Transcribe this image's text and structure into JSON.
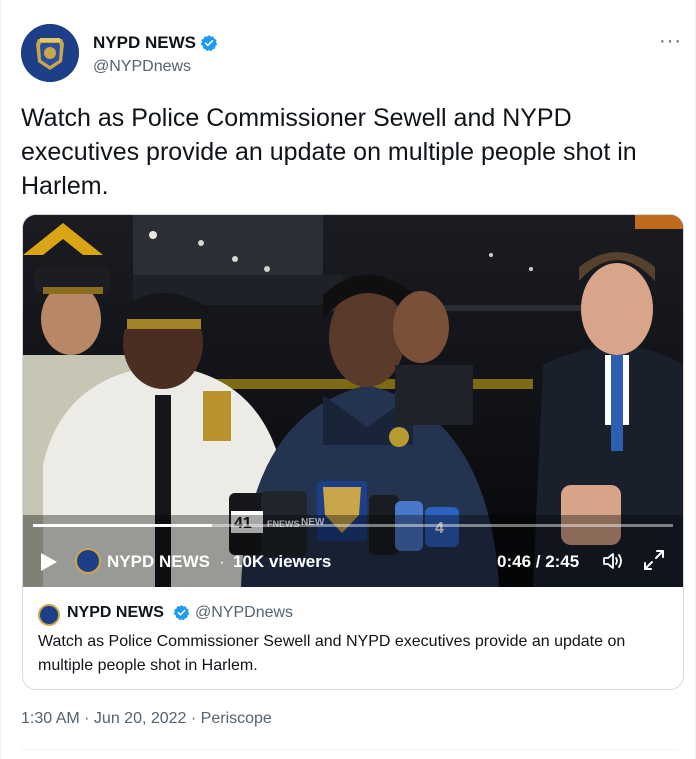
{
  "author": {
    "display_name": "NYPD NEWS",
    "handle": "@NYPDnews",
    "verified": true
  },
  "more_icon": "more-horizontal-icon",
  "tweet_text": "Watch as Police Commissioner Sewell and NYPD executives provide an update on multiple people shot in Harlem.",
  "video": {
    "channel_name": "NYPD NEWS",
    "separator": "·",
    "viewers": "10K viewers",
    "time": "0:46 / 2:45",
    "progress": 0.279,
    "mic_labels": [
      "41",
      "FNEWS",
      "NEW",
      "4"
    ]
  },
  "card": {
    "display_name": "NYPD NEWS",
    "handle": "@NYPDnews",
    "text": "Watch as Police Commissioner Sewell and NYPD executives provide an update on multiple people shot in Harlem."
  },
  "meta": {
    "text": "1:30 AM · Jun 20, 2022 · Periscope"
  },
  "colors": {
    "accent": "#1d9bf0",
    "secondary_text": "#536471",
    "border": "#cfd9de"
  }
}
